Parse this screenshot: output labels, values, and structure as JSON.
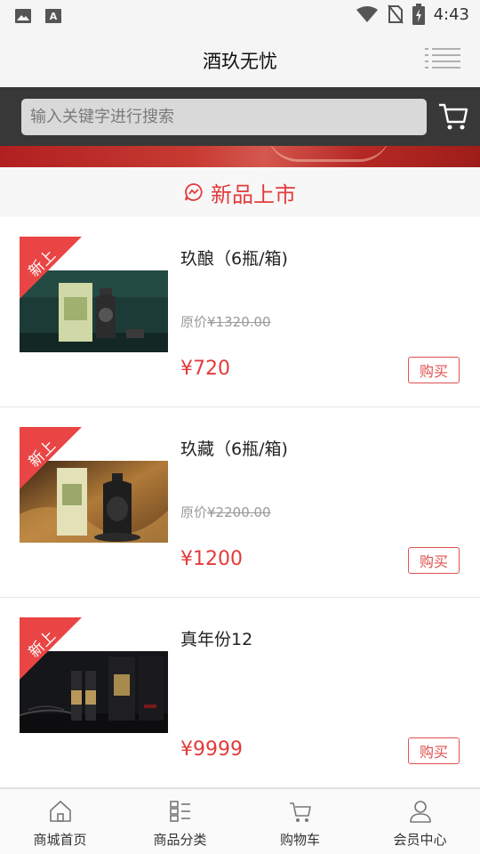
{
  "status_bar": {
    "time": "4:43",
    "icons": [
      "image-icon",
      "font-icon",
      "wifi-icon",
      "no-sim-icon",
      "battery-charging-icon"
    ]
  },
  "header": {
    "title": "酒玖无忧",
    "menu_icon": "list-menu-icon"
  },
  "search": {
    "placeholder": "输入关键字进行搜索",
    "cart_icon": "cart-icon"
  },
  "section": {
    "title": "新品上市",
    "icon": "chat-bubble-icon",
    "accent_color": "#e23b3b"
  },
  "products": [
    {
      "badge": "新上",
      "name": "玖酿（6瓶/箱)",
      "orig_label": "原价",
      "orig_price": "¥1320.00",
      "price": "¥720",
      "buy_label": "购买"
    },
    {
      "badge": "新上",
      "name": "玖藏（6瓶/箱)",
      "orig_label": "原价",
      "orig_price": "¥2200.00",
      "price": "¥1200",
      "buy_label": "购买"
    },
    {
      "badge": "新上",
      "name": "真年份12",
      "orig_label": "",
      "orig_price": "",
      "price": "¥9999",
      "buy_label": "购买"
    }
  ],
  "bottom_nav": [
    {
      "label": "商城首页",
      "icon": "home-icon"
    },
    {
      "label": "商品分类",
      "icon": "category-icon"
    },
    {
      "label": "购物车",
      "icon": "cart-icon"
    },
    {
      "label": "会员中心",
      "icon": "user-icon"
    }
  ]
}
